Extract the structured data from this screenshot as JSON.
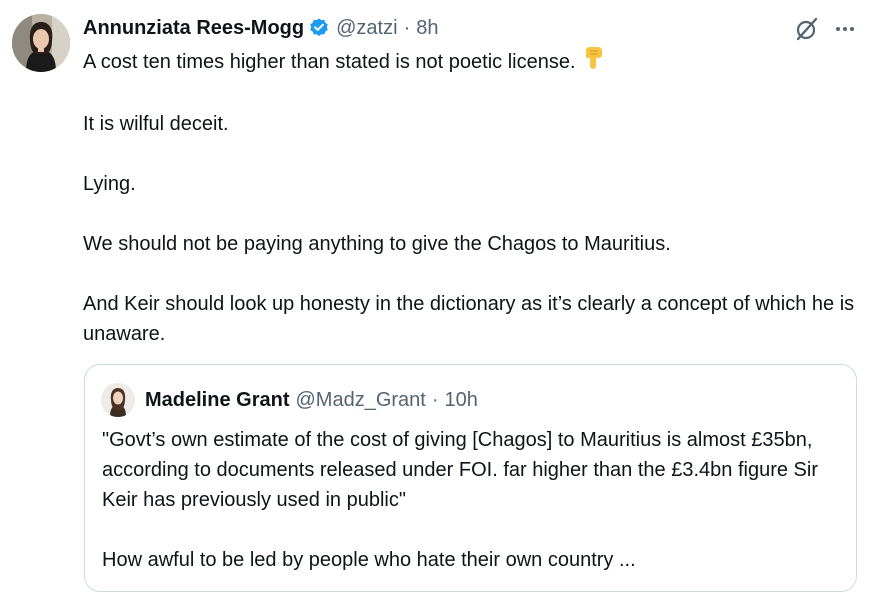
{
  "author": {
    "display_name": "Annunziata Rees-Mogg",
    "handle": "@zatzi",
    "separator": "·",
    "time": "8h",
    "verified_icon": "verified-badge-icon"
  },
  "actions": {
    "grok_icon": "grok-icon",
    "more_icon": "more-icon",
    "more_label": "···"
  },
  "post": {
    "line1": "A cost ten times higher than stated is not poetic license.",
    "line1_emoji": "backhand-index-pointing-down-emoji",
    "line2": "It is wilful deceit.",
    "line3": "Lying.",
    "line4": "We should not be paying anything to give the Chagos to Mauritius.",
    "line5": "And Keir should look up honesty in the dictionary as it’s clearly a concept of which he is unaware."
  },
  "quoted": {
    "display_name": "Madeline Grant",
    "handle": "@Madz_Grant",
    "separator": "·",
    "time": "10h",
    "paragraph1": "\"Govt’s own estimate of the cost of giving [Chagos] to Mauritius is almost £35bn, according to documents released under FOI. far higher than the £3.4bn figure Sir Keir has previously used in public\"",
    "paragraph2": "How awful to be led by people who hate their own country ..."
  },
  "colors": {
    "text_primary": "#0f1419",
    "text_secondary": "#536471",
    "verified_blue": "#1d9bf0",
    "border": "#cfd9de"
  }
}
